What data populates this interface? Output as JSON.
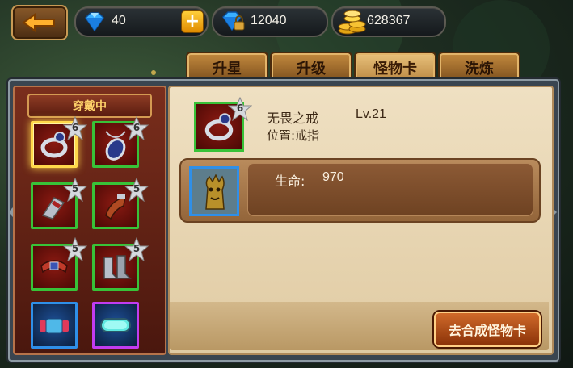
{
  "currency": {
    "gems": "40",
    "locked_gems": "12040",
    "gold": "628367"
  },
  "tabs": [
    {
      "label": "升星"
    },
    {
      "label": "升级"
    },
    {
      "label": "怪物卡"
    },
    {
      "label": "洗炼"
    }
  ],
  "active_tab": "怪物卡",
  "equipped": {
    "header": "穿戴中",
    "slots": [
      {
        "icon": "ring-icon",
        "stars": "6",
        "selected": true
      },
      {
        "icon": "amulet-icon",
        "stars": "6"
      },
      {
        "icon": "bracer-icon",
        "stars": "5"
      },
      {
        "icon": "glove-icon",
        "stars": "5"
      },
      {
        "icon": "belt-icon",
        "stars": "5"
      },
      {
        "icon": "boots-icon",
        "stars": "5"
      },
      {
        "icon": "dumbbell-icon"
      },
      {
        "icon": "goggles-icon"
      }
    ]
  },
  "item": {
    "name": "无畏之戒",
    "level": "Lv.21",
    "position": "位置:戒指",
    "stars": "6"
  },
  "card": {
    "icon": "tree-monster-icon",
    "stat_label": "生命:",
    "stat_value": "970"
  },
  "compose_button": "去合成怪物卡",
  "colors": {
    "slot_border_green": "#38c238",
    "slot_border_blue": "#2f8fe8",
    "slot_border_purple": "#c23cf0",
    "selected_glow": "#ffd84a",
    "tab_active": "#e9c27c"
  }
}
